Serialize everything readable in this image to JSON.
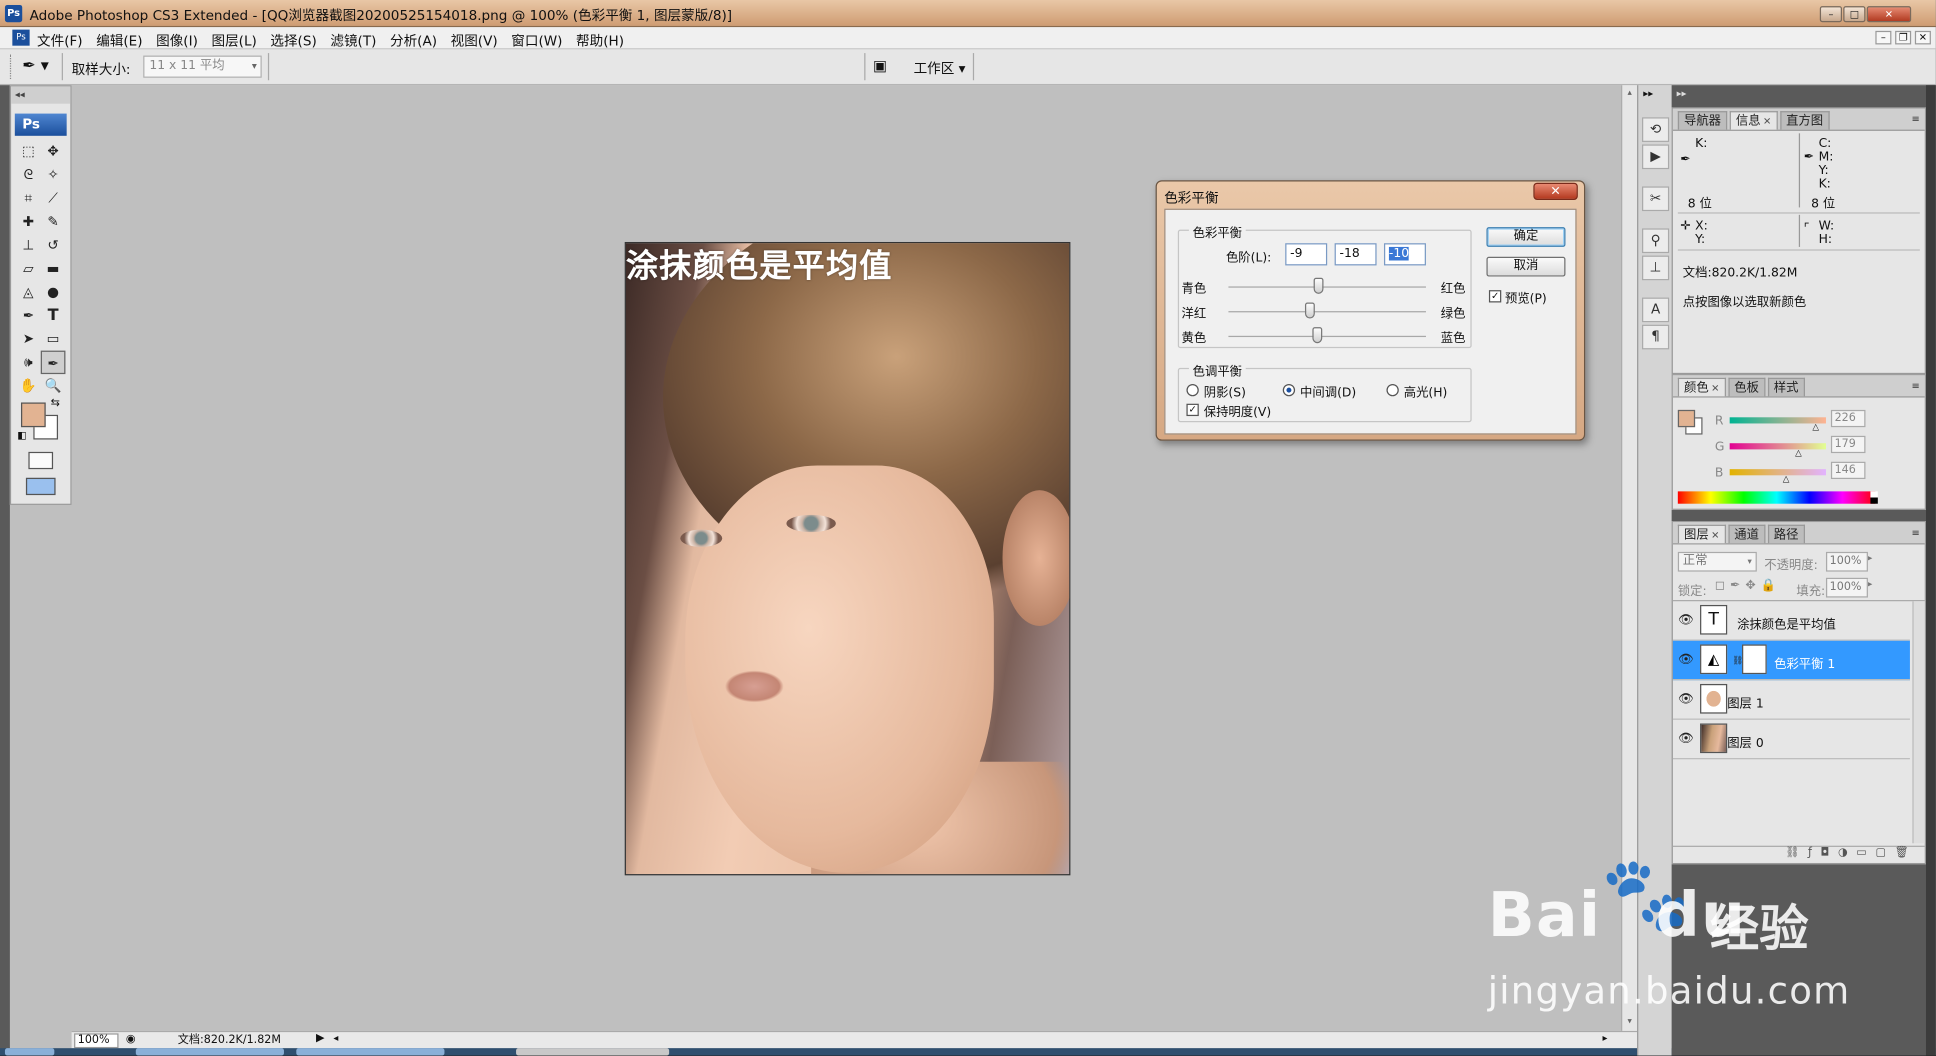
{
  "window": {
    "title": "Adobe Photoshop CS3 Extended - [QQ浏览器截图20200525154018.png @ 100% (色彩平衡 1, 图层蒙版/8)]",
    "app_icon": "Ps",
    "doc_icon": "Ps"
  },
  "menu": [
    "文件(F)",
    "编辑(E)",
    "图像(I)",
    "图层(L)",
    "选择(S)",
    "滤镜(T)",
    "分析(A)",
    "视图(V)",
    "窗口(W)",
    "帮助(H)"
  ],
  "options": {
    "sample_label": "取样大小:",
    "sample_value": "11 x 11 平均",
    "workspace": "工作区"
  },
  "toolbox": {
    "logo": "Ps"
  },
  "canvas": {
    "overlay_text": "涂抹颜色是平均值"
  },
  "status": {
    "zoom": "100%",
    "doc": "文档:820.2K/1.82M"
  },
  "dialog": {
    "title": "色彩平衡",
    "group1": "色彩平衡",
    "levels_label": "色阶(L):",
    "levels": [
      "-9",
      "-18",
      "-10"
    ],
    "sliders": [
      {
        "left": "青色",
        "right": "红色",
        "value": -9
      },
      {
        "left": "洋红",
        "right": "绿色",
        "value": -18
      },
      {
        "left": "黄色",
        "right": "蓝色",
        "value": -10
      }
    ],
    "group2": "色调平衡",
    "shadows": "阴影(S)",
    "midtones": "中间调(D)",
    "highlights": "高光(H)",
    "preserve": "保持明度(V)",
    "ok": "确定",
    "cancel": "取消",
    "preview": "预览(P)",
    "selected_tone": "midtones",
    "preserve_checked": true,
    "preview_checked": true
  },
  "info_panel": {
    "tabs": [
      "导航器",
      "信息",
      "直方图"
    ],
    "k": "K:",
    "bits1": "8 位",
    "c": "C:",
    "m": "M:",
    "y": "Y:",
    "k2": "K:",
    "bits2": "8 位",
    "x": "X:",
    "y2": "Y:",
    "w": "W:",
    "h": "H:",
    "doc": "文档:820.2K/1.82M",
    "hint": "点按图像以选取新颜色"
  },
  "color_panel": {
    "tabs": [
      "颜色",
      "色板",
      "样式"
    ],
    "r_label": "R",
    "g_label": "G",
    "b_label": "B",
    "r": "226",
    "g": "179",
    "b": "146",
    "fg_color": "#e2b392"
  },
  "layers_panel": {
    "tabs": [
      "图层",
      "通道",
      "路径"
    ],
    "blend": "正常",
    "opacity_label": "不透明度:",
    "opacity": "100%",
    "lock_label": "锁定:",
    "fill_label": "填充:",
    "fill": "100%",
    "layers": [
      {
        "name": "涂抹颜色是平均值",
        "type": "text",
        "thumb": "T"
      },
      {
        "name": "色彩平衡 1",
        "type": "adjustment",
        "selected": true
      },
      {
        "name": "图层 1",
        "type": "pixel"
      },
      {
        "name": "图层 0",
        "type": "photo"
      }
    ]
  },
  "watermark": {
    "logo": "Bai",
    "logo_suffix": "du",
    "brand_cn": "经验",
    "url": "jingyan.baidu.com"
  }
}
